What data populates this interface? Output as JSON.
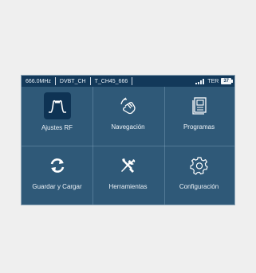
{
  "status": {
    "frequency": "666.0MHz",
    "standard": "DVBT_CH",
    "service": "T_CH45_666",
    "mode": "TER",
    "battery": "37"
  },
  "tiles": [
    {
      "label": "Ajustes RF",
      "icon": "rf-waveform-icon",
      "active": true
    },
    {
      "label": "Navegación",
      "icon": "hand-touch-icon",
      "active": false
    },
    {
      "label": "Programas",
      "icon": "tv-programs-icon",
      "active": false
    },
    {
      "label": "Guardar y Cargar",
      "icon": "refresh-arrows-icon",
      "active": false
    },
    {
      "label": "Herramientas",
      "icon": "wrench-screwdriver-icon",
      "active": false
    },
    {
      "label": "Configuración",
      "icon": "gear-icon",
      "active": false
    }
  ],
  "colors": {
    "screen_bg": "#2f5978",
    "statusbar_bg": "#13395a",
    "active_tile_bg": "#0e3354",
    "text": "#eef3f8"
  }
}
